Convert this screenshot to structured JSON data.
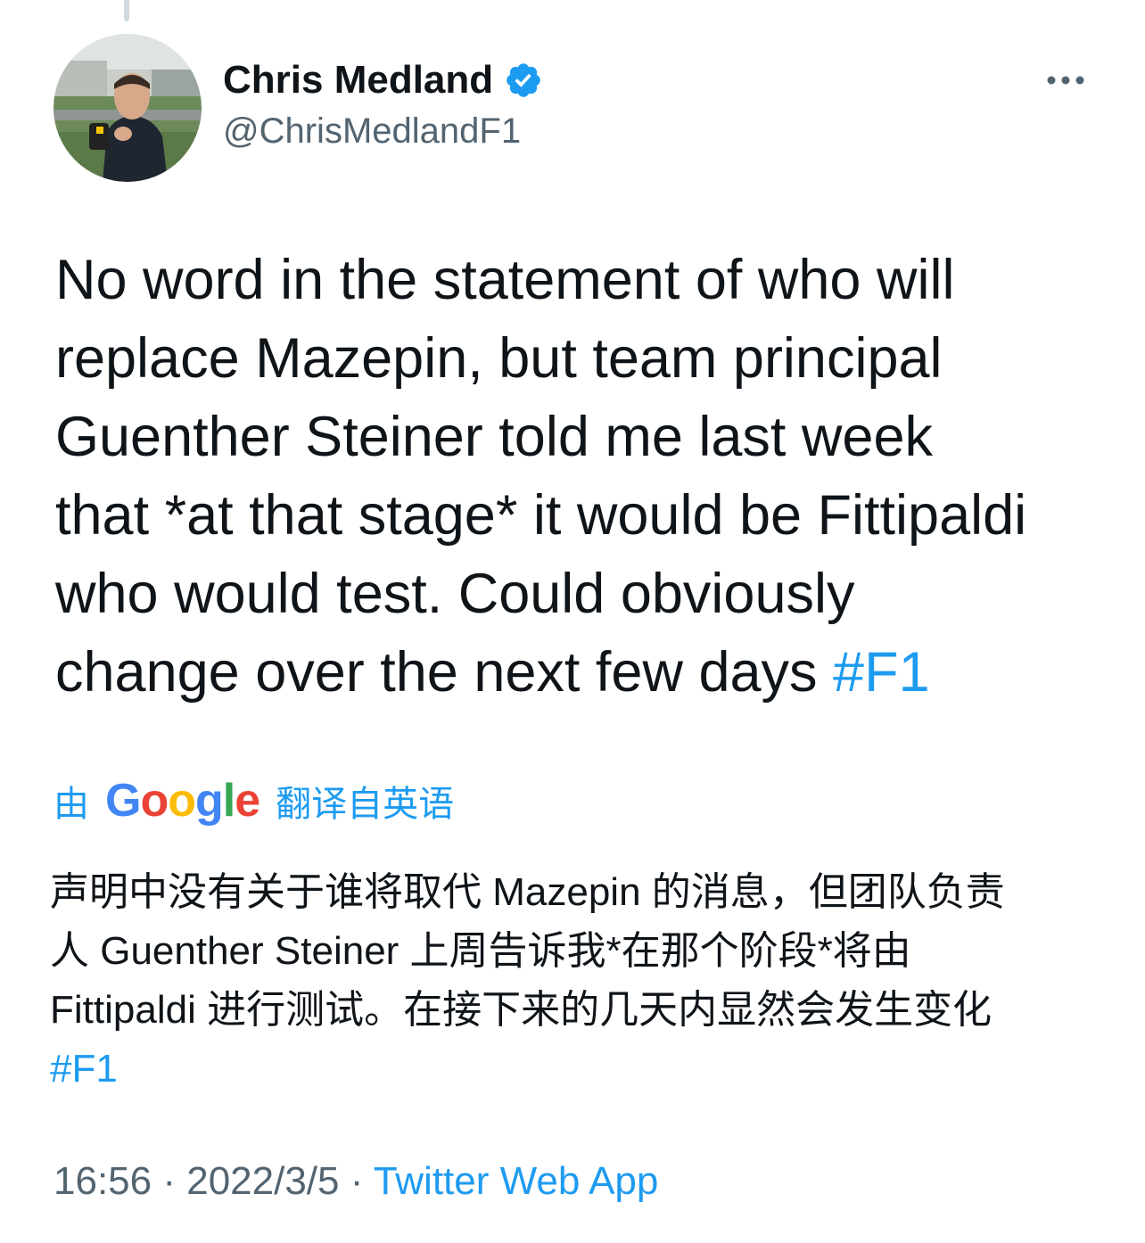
{
  "author": {
    "display_name": "Chris Medland",
    "handle": "@ChrisMedlandF1",
    "verified": true
  },
  "tweet": {
    "lines": [
      "No word in the statement of who will",
      "replace Mazepin, but team principal",
      "Guenther Steiner told me last week",
      "that *at that stage* it would be Fittipaldi",
      "who would test. Could obviously",
      "change over the next few days "
    ],
    "hashtag": "#F1"
  },
  "translation": {
    "prefix": "由",
    "provider_letters": [
      "G",
      "o",
      "o",
      "g",
      "l",
      "e"
    ],
    "suffix": "翻译自英语",
    "lines": [
      "声明中没有关于谁将取代 Mazepin 的消息，但团队负责",
      "人 Guenther Steiner 上周告诉我*在那个阶段*将由",
      "Fittipaldi 进行测试。在接下来的几天内显然会发生变化"
    ],
    "hashtag": "#F1"
  },
  "meta": {
    "time": "16:56",
    "separator": " · ",
    "date": "2022/3/5",
    "source": "Twitter Web App"
  },
  "colors": {
    "accent": "#1d9bf0",
    "text": "#0f1419",
    "secondary": "#536471"
  },
  "icons": {
    "more": "more-horizontal-icon",
    "verified": "verified-badge-icon"
  }
}
